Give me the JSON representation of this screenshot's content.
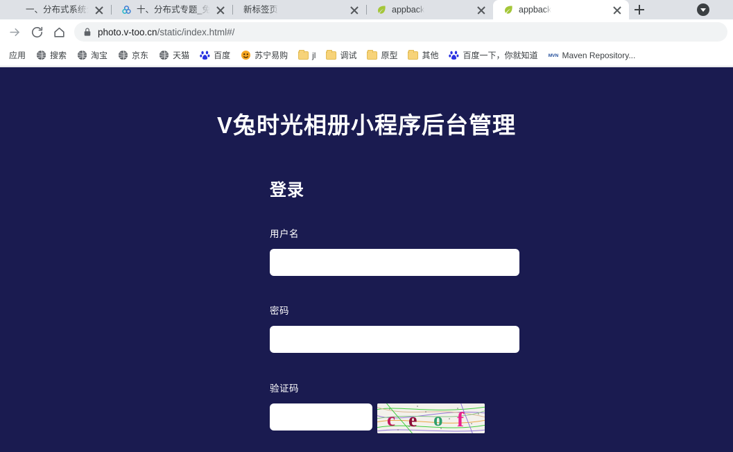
{
  "browser": {
    "tabs": [
      {
        "title": "一、分布式系统介绍以",
        "favicon": "none",
        "active": false,
        "has_divider": false
      },
      {
        "title": "十、分布式专题_免费高",
        "favicon": "blue-circles-icon",
        "active": false,
        "has_divider": true
      },
      {
        "title": "新标签页",
        "favicon": "none",
        "active": false,
        "has_divider": true
      },
      {
        "title": "appback",
        "favicon": "green-leaf-icon",
        "active": false,
        "has_divider": true
      },
      {
        "title": "appback",
        "favicon": "green-leaf-icon",
        "active": true,
        "has_divider": false
      }
    ],
    "new_tab_label": "+",
    "toolbar": {
      "forward_icon": "forward-arrow-icon",
      "reload_icon": "reload-icon",
      "home_icon": "home-icon",
      "lock_icon": "lock-icon",
      "url_host": "photo.v-too.cn",
      "url_path": "/static/index.html#/"
    },
    "bookmarks": [
      {
        "label": "应用",
        "icon": "apps-icon"
      },
      {
        "label": "搜索",
        "icon": "globe-icon"
      },
      {
        "label": "淘宝",
        "icon": "globe-icon"
      },
      {
        "label": "京东",
        "icon": "globe-icon"
      },
      {
        "label": "天猫",
        "icon": "globe-icon"
      },
      {
        "label": "百度",
        "icon": "baidu-paw-icon"
      },
      {
        "label": "苏宁易购",
        "icon": "suning-icon"
      },
      {
        "label": "jl",
        "icon": "folder-icon"
      },
      {
        "label": "调试",
        "icon": "folder-icon"
      },
      {
        "label": "原型",
        "icon": "folder-icon"
      },
      {
        "label": "其他",
        "icon": "folder-icon"
      },
      {
        "label": "百度一下，你就知道",
        "icon": "baidu-paw-icon"
      },
      {
        "label": "Maven Repository...",
        "icon": "maven-icon"
      }
    ]
  },
  "page": {
    "title": "V兔时光相册小程序后台管理",
    "login": {
      "heading": "登录",
      "username_label": "用户名",
      "username_value": "",
      "username_placeholder": "",
      "password_label": "密码",
      "password_value": "",
      "password_placeholder": "",
      "captcha_label": "验证码",
      "captcha_value": "",
      "captcha_placeholder": "",
      "captcha_text": "ceof",
      "captcha_letters": [
        {
          "char": "c",
          "color": "#c2185b"
        },
        {
          "char": "e",
          "color": "#8e1039"
        },
        {
          "char": "o",
          "color": "#2e9e6b"
        },
        {
          "char": "f",
          "color": "#e91e8c"
        }
      ]
    }
  },
  "colors": {
    "page_background": "#1a1b50",
    "text_on_dark": "#ffffff",
    "input_background": "#ffffff",
    "browser_tabstrip": "#dee1e6",
    "omnibox_background": "#f1f3f4"
  }
}
